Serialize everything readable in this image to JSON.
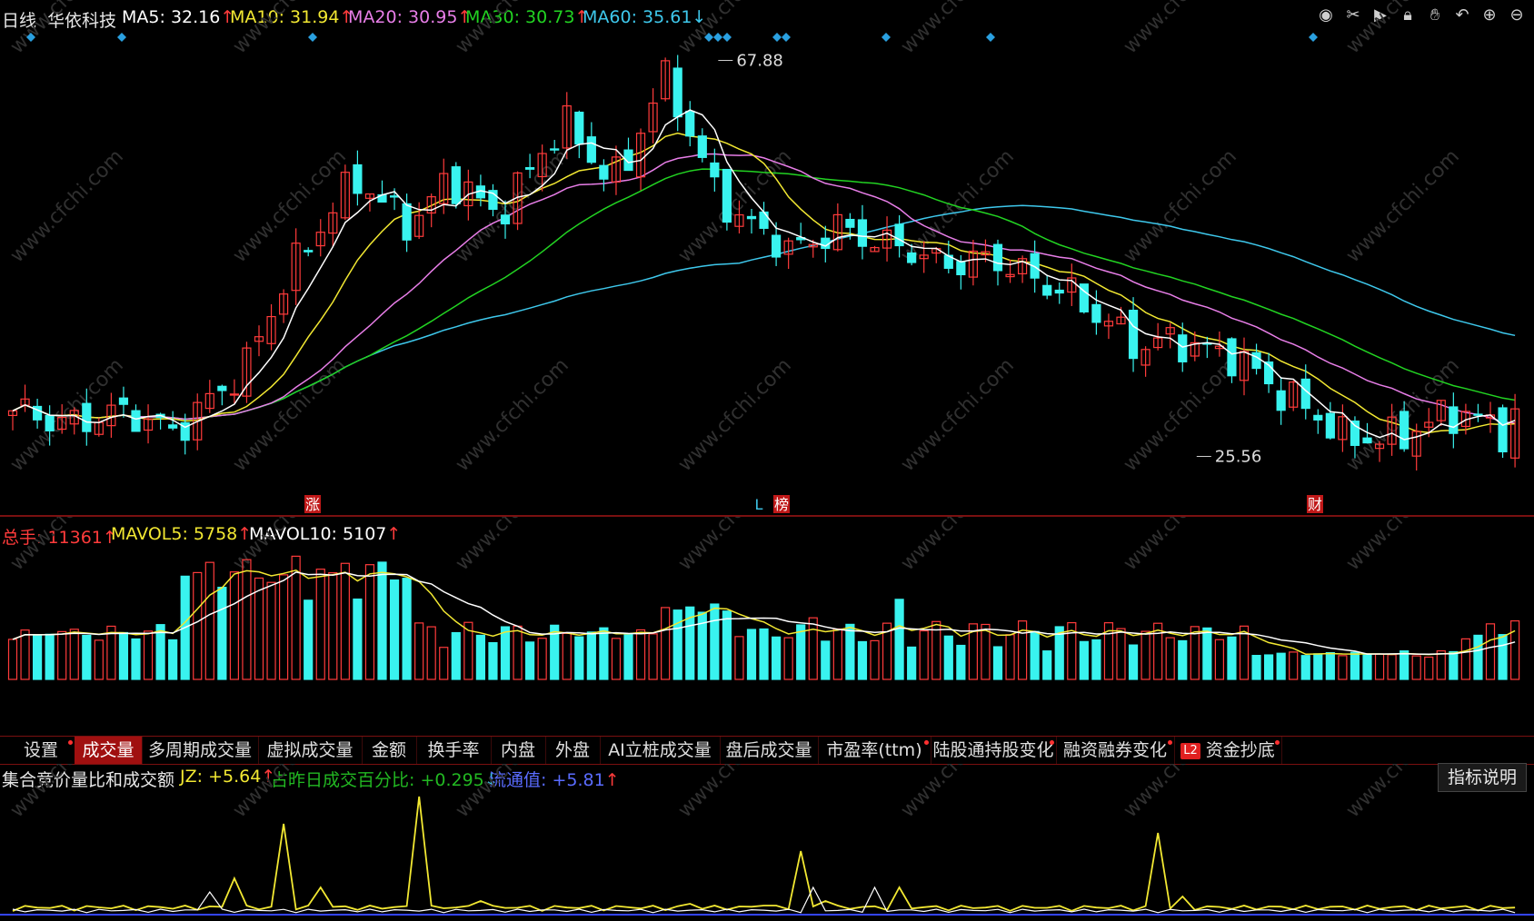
{
  "header": {
    "period": "日线",
    "stock_name": "华依科技",
    "ma": [
      {
        "label": "MA5:",
        "value": "32.16",
        "arrow": "↑",
        "color": "#ffffff"
      },
      {
        "label": "MA10:",
        "value": "31.94",
        "arrow": "↑",
        "color": "#f2e832"
      },
      {
        "label": "MA20:",
        "value": "30.95",
        "arrow": "↑",
        "color": "#e87ee8"
      },
      {
        "label": "MA30:",
        "value": "30.73",
        "arrow": "↑",
        "color": "#22d322"
      },
      {
        "label": "MA60:",
        "value": "35.61",
        "arrow": "↓",
        "color": "#3ec8ec"
      }
    ],
    "tools": [
      "eye-icon",
      "scissors-icon",
      "play-icon",
      "lock-icon",
      "hand-icon",
      "undo-icon",
      "zoom-in-icon",
      "zoom-out-icon"
    ]
  },
  "price_chart": {
    "high_label": "67.88",
    "low_label": "25.56",
    "markers": [
      {
        "text": "涨",
        "bg": "#c01818"
      },
      {
        "text": "L",
        "bg": "none"
      },
      {
        "text": "榜",
        "bg": "#c01818"
      },
      {
        "text": "财",
        "bg": "#c01818"
      }
    ]
  },
  "volume_panel": {
    "total_label": "总手:",
    "total_value": "11361",
    "total_arrow": "↑",
    "mavol5_label": "MAVOL5:",
    "mavol5_value": "5758",
    "mavol5_arrow": "↑",
    "mavol10_label": "MAVOL10:",
    "mavol10_value": "5107",
    "mavol10_arrow": "↑"
  },
  "tabs": [
    {
      "label": "设置",
      "dot": true
    },
    {
      "label": "成交量",
      "dot": false,
      "active": true
    },
    {
      "label": "多周期成交量",
      "dot": false
    },
    {
      "label": "虚拟成交量",
      "dot": false
    },
    {
      "label": "金额",
      "dot": false
    },
    {
      "label": "换手率",
      "dot": false
    },
    {
      "label": "内盘",
      "dot": false
    },
    {
      "label": "外盘",
      "dot": false
    },
    {
      "label": "AI立桩成交量",
      "dot": false
    },
    {
      "label": "盘后成交量",
      "dot": false
    },
    {
      "label": "市盈率(ttm)",
      "dot": true
    },
    {
      "label": "陆股通持股变化",
      "dot": true
    },
    {
      "label": "融资融券变化",
      "dot": true
    },
    {
      "label": "资金抄底",
      "dot": true,
      "badge": "L2"
    }
  ],
  "indicator_panel": {
    "title": "集合竞价量比和成交额",
    "jz_label": "JZ:",
    "jz_value": "+5.64",
    "jz_arrow": "↑",
    "pct_label": "占昨日成交百分比:",
    "pct_value": "+0.295",
    "pct_arrow": "↓",
    "float_label": "流通值:",
    "float_value": "+5.81",
    "float_arrow": "↑",
    "explain_button": "指标说明"
  },
  "watermark": "www.cfchi.com",
  "colors": {
    "up": "#ff3b3b",
    "down": "#39f3ef",
    "ma5": "#ffffff",
    "ma10": "#f2e832",
    "ma20": "#e87ee8",
    "ma30": "#22d322",
    "ma60": "#3ec8ec",
    "border": "#7a1010"
  }
}
